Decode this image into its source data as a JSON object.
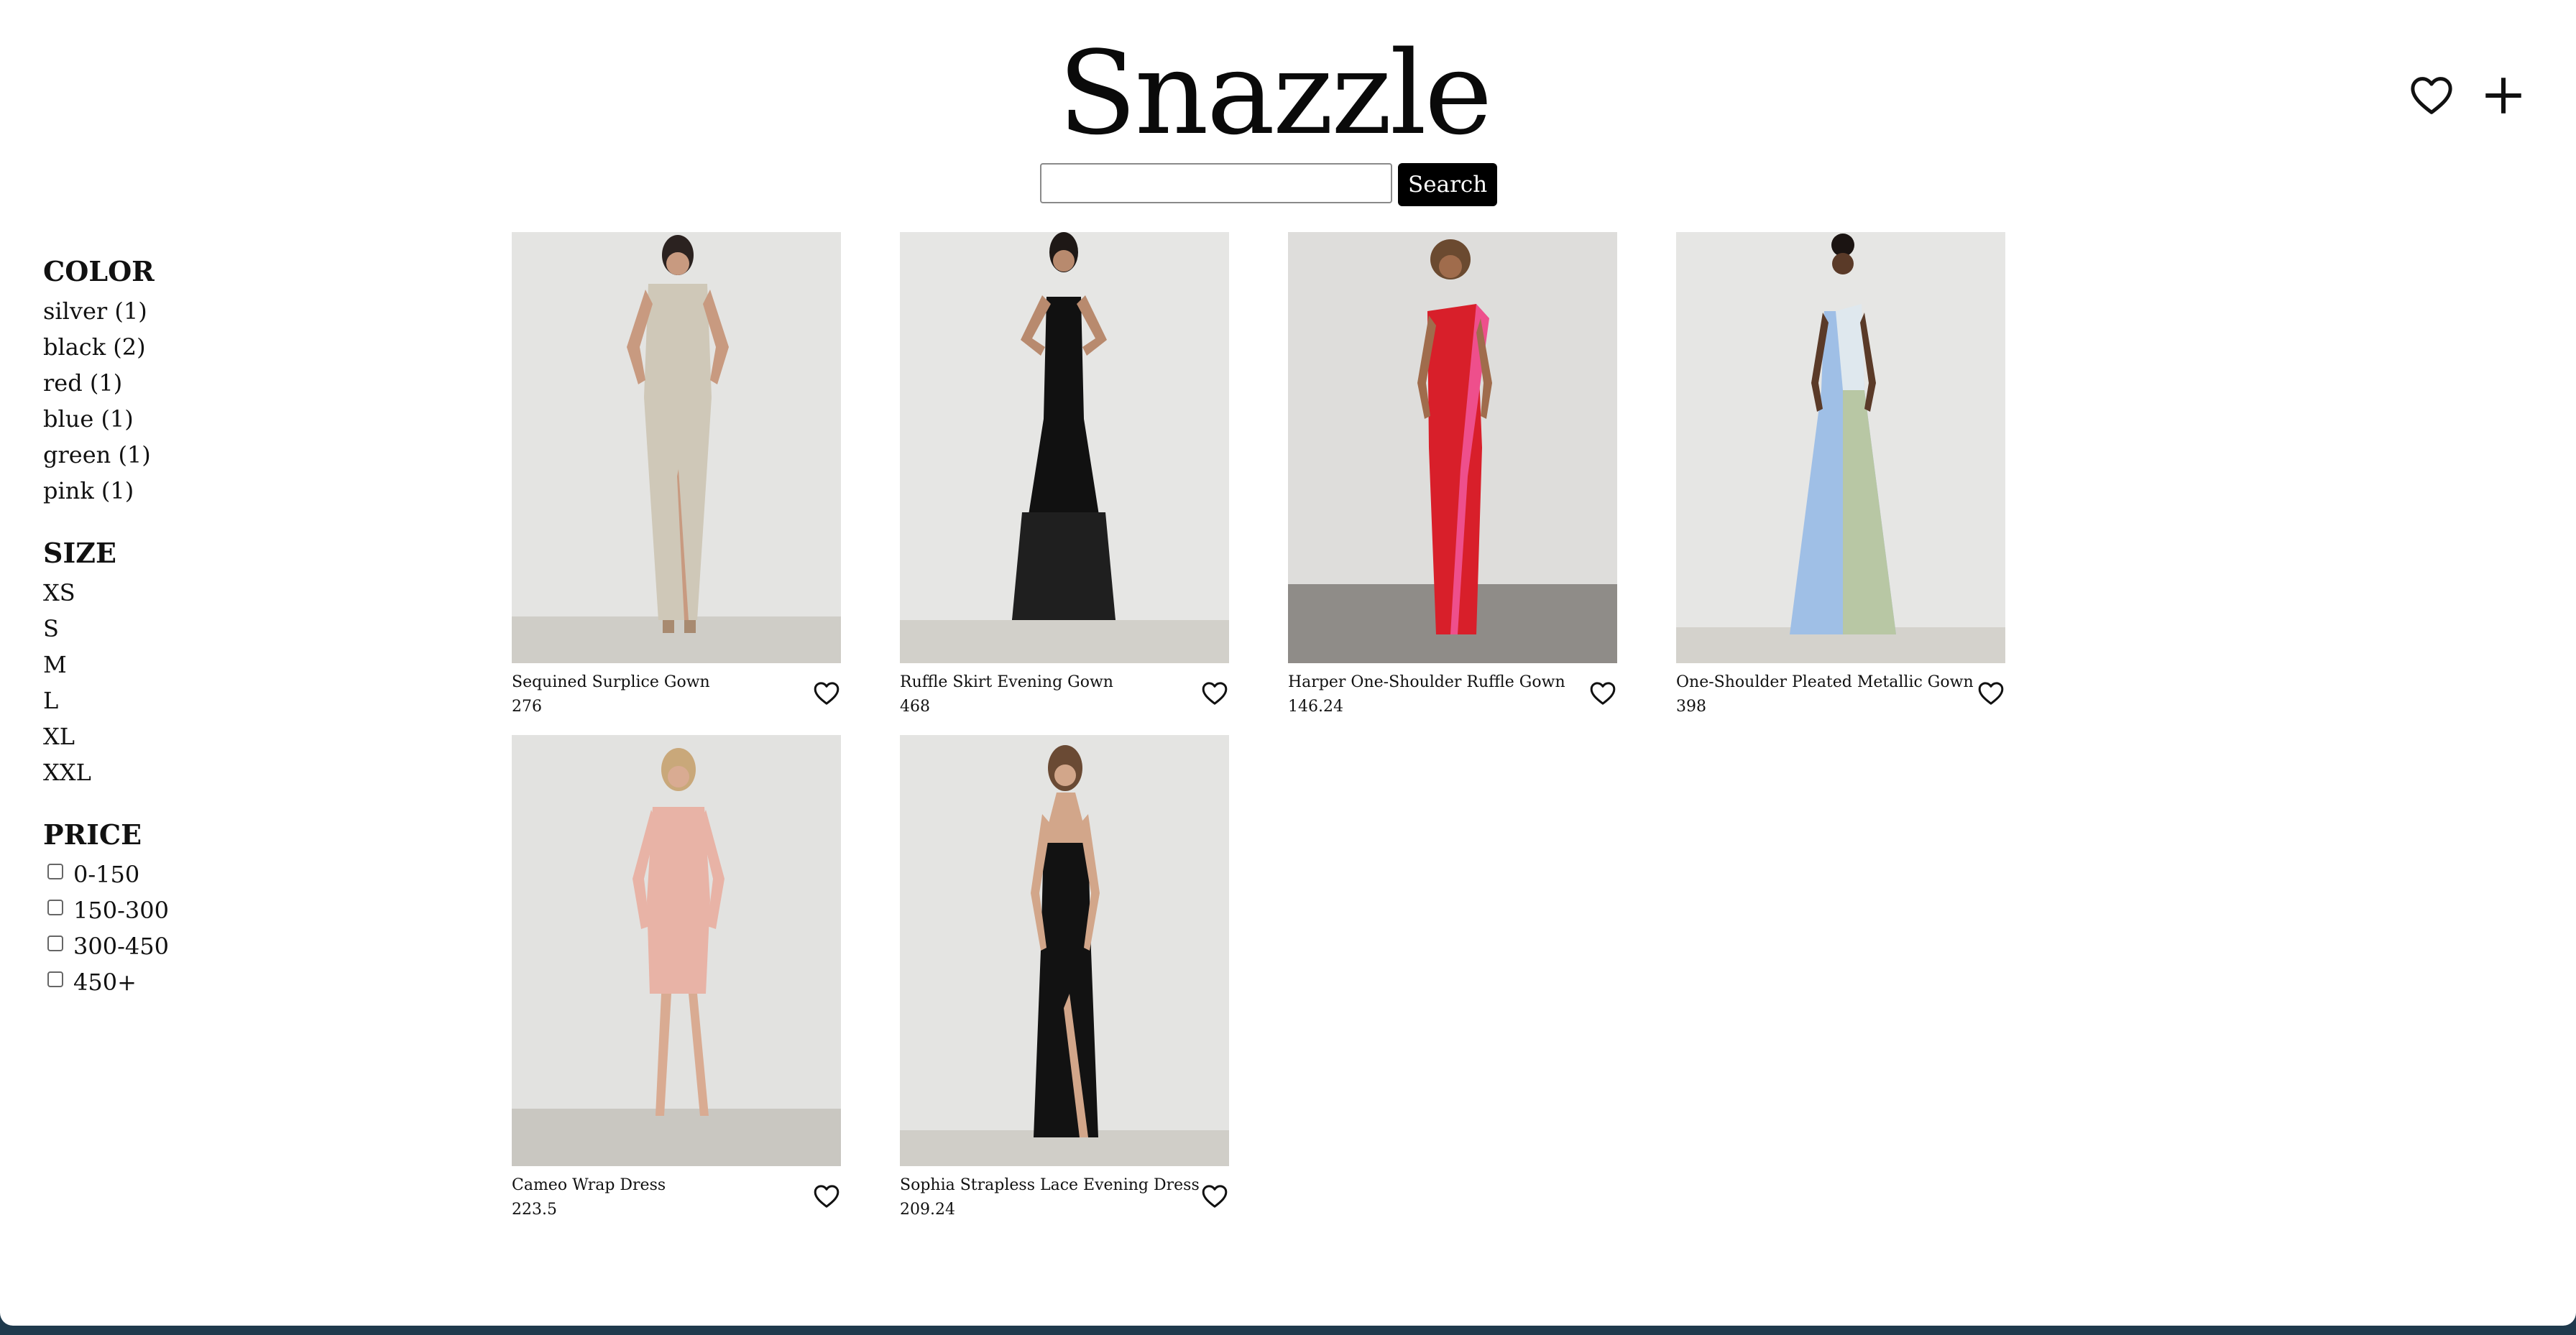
{
  "brand": {
    "title": "Snazzle"
  },
  "header": {
    "icons": [
      "heart-icon",
      "plus-icon"
    ]
  },
  "search": {
    "value": "",
    "placeholder": "",
    "button_label": "Search"
  },
  "filters": {
    "color": {
      "heading": "COLOR",
      "options": [
        "silver (1)",
        "black (2)",
        "red (1)",
        "blue (1)",
        "green (1)",
        "pink (1)"
      ]
    },
    "size": {
      "heading": "SIZE",
      "options": [
        "XS",
        "S",
        "M",
        "L",
        "XL",
        "XXL"
      ]
    },
    "price": {
      "heading": "PRICE",
      "options": [
        {
          "label": "0-150",
          "checked": false
        },
        {
          "label": "150-300",
          "checked": false
        },
        {
          "label": "300-450",
          "checked": false
        },
        {
          "label": "450+",
          "checked": false
        }
      ]
    }
  },
  "products": [
    {
      "name": "Sequined Surplice Gown",
      "price": "276",
      "dress_color": "#cfc8b8"
    },
    {
      "name": "Ruffle Skirt Evening Gown",
      "price": "468",
      "dress_color": "#111111"
    },
    {
      "name": "Harper One-Shoulder Ruffle Gown",
      "price": "146.24",
      "dress_color": "#d81f2a",
      "accent_color": "#ee4f8c"
    },
    {
      "name": "One-Shoulder Pleated Metallic Gown",
      "price": "398",
      "dress_color": "#9fbfe6",
      "accent_color": "#b8c7a4"
    },
    {
      "name": "Cameo Wrap Dress",
      "price": "223.5",
      "dress_color": "#e8b3a6"
    },
    {
      "name": "Sophia Strapless Lace Evening Dress",
      "price": "209.24",
      "dress_color": "#121212"
    }
  ]
}
